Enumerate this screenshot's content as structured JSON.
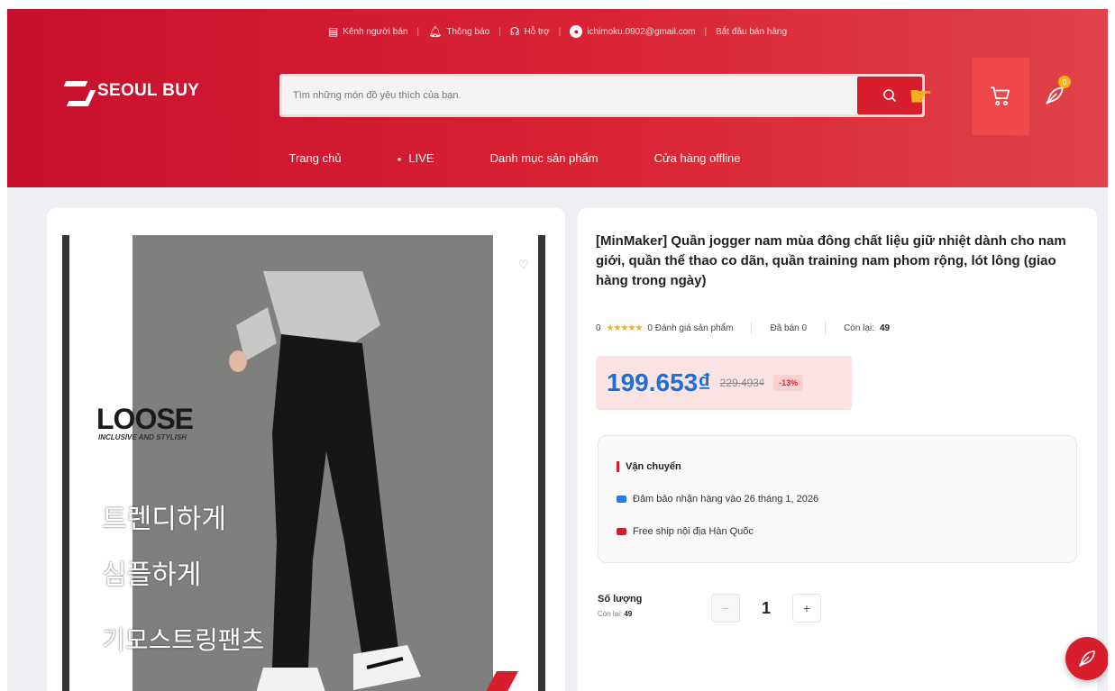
{
  "topbar": {
    "seller_channel": "Kênh người bán",
    "notifications": "Thông báo",
    "support": "Hỗ trợ",
    "account_email": "ichimoku.0902@gmail.com",
    "start_selling": "Bắt đầu bán hàng"
  },
  "brand": {
    "name": "SEOUL BUY"
  },
  "search": {
    "placeholder": "Tìm những món đồ yêu thích của bạn."
  },
  "header_icons": {
    "user_badge_count": "0"
  },
  "nav": {
    "home": "Trang chủ",
    "live": "LIVE",
    "categories": "Danh mục sản phẩm",
    "offline_store": "Cửa hàng offline"
  },
  "product_image": {
    "headline": "LOOSE",
    "subline": "INCLUSIVE AND STYLISH",
    "korean_line1": "트렌디하게",
    "korean_line2": "심플하게",
    "korean_line3": "기모스트링팬츠"
  },
  "product": {
    "title": "[MinMaker] Quần jogger nam mùa đông chất liệu giữ nhiệt dành cho nam giới, quần thể thao co dãn, quần training nam phom rộng, lót lông (giao hàng trong ngày)",
    "rating_value": "0",
    "rating_stars": "★★★★★",
    "review_text": "0 Đánh giá sản phẩm",
    "sold_text": "Đã bán 0",
    "stock_label": "Còn lại:",
    "stock_value": "49",
    "price": "199.653₫",
    "old_price": "229.493₫",
    "discount": "-13%"
  },
  "shipping": {
    "title": "Vận chuyển",
    "delivery": "Đảm bảo nhận hàng vào 26 tháng 1, 2026",
    "free_ship": "Free ship nội địa Hàn Quốc"
  },
  "quantity": {
    "label": "Số lượng",
    "stock_label": "Còn lại:",
    "stock_value": "49",
    "minus": "−",
    "value": "1",
    "plus": "+"
  },
  "colors": {
    "brand_red": "#d81e2d",
    "cart_highlight": "#f04848",
    "price_blue": "#1d6fd6",
    "star_yellow": "#f2b21a"
  }
}
